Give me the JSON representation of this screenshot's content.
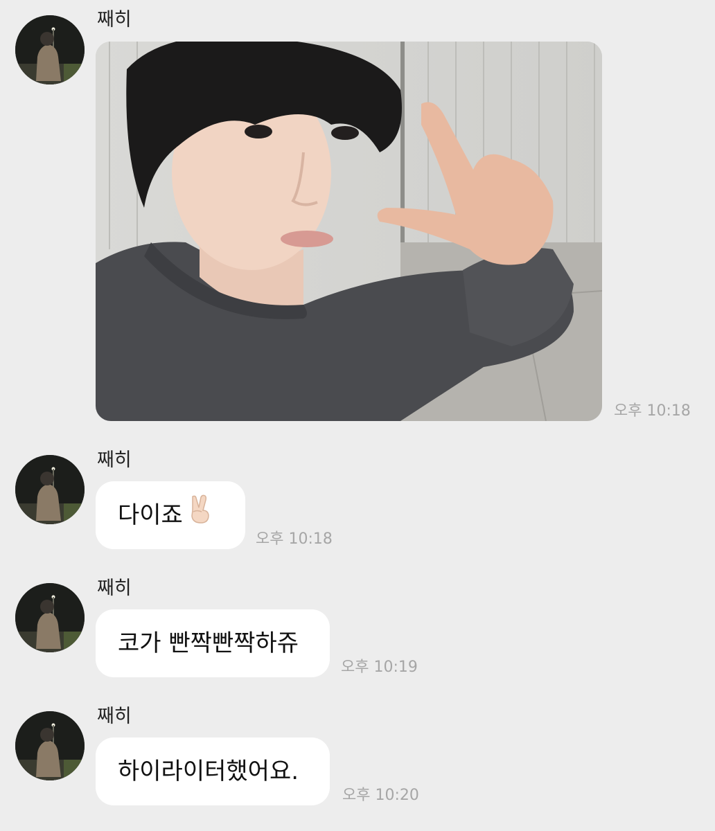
{
  "messages": [
    {
      "sender": "째히",
      "type": "photo",
      "time": "오후 10:18"
    },
    {
      "sender": "째히",
      "type": "text",
      "text": "다이죠",
      "emoji": "victory-hand",
      "time": "오후 10:18"
    },
    {
      "sender": "째히",
      "type": "text",
      "text": "코가 빤짝빤짝하쥬",
      "time": "오후 10:19"
    },
    {
      "sender": "째히",
      "type": "text",
      "text": "하이라이터했어요.",
      "time": "오후 10:20"
    }
  ],
  "colors": {
    "background": "#ededed",
    "bubble": "#ffffff",
    "timestamp": "#a6a6a6"
  }
}
